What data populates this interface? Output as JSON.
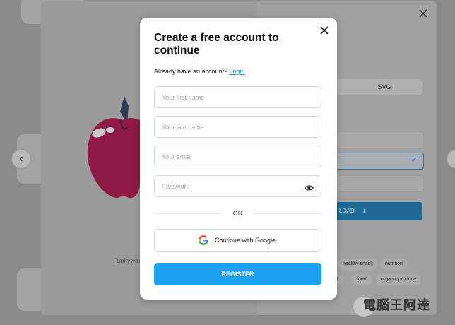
{
  "modal": {
    "title": "Create a free account to continue",
    "login_prompt": "Already have an account?",
    "login_link": "Login",
    "first_name_placeholder": "Your first name",
    "last_name_placeholder": "Your last name",
    "email_placeholder": "Your email",
    "password_placeholder": "Password",
    "or_text": "OR",
    "google_button": "Continue with Google",
    "register_button": "REGISTER"
  },
  "background": {
    "author_partial": "Funkyway",
    "format_option": "SVG",
    "download_partial": "LOAD",
    "tags": [
      "healthy snack",
      "nutrition",
      "nt",
      "food",
      "organic produce"
    ],
    "watermark": "電腦王阿達"
  },
  "colors": {
    "accent": "#1aa0f0",
    "link": "#1d8fd6",
    "overlay": "#8a8a8a"
  },
  "icons": {
    "close": "close-icon",
    "eye": "eye-icon",
    "google": "google-icon",
    "prev": "chevron-left-icon",
    "check": "check-icon"
  }
}
